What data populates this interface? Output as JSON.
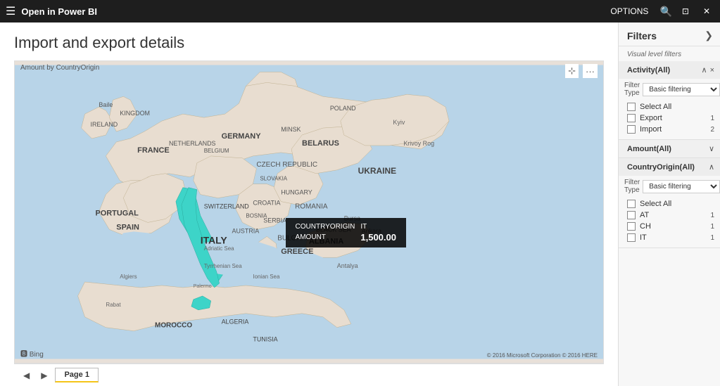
{
  "titlebar": {
    "title": "Open in Power BI",
    "options_label": "OPTIONS",
    "search_icon": "🔍",
    "window_controls": [
      "⊡",
      "×"
    ]
  },
  "page": {
    "title": "Import and export details",
    "nav": {
      "prev_arrow": "◀",
      "next_arrow": "▶",
      "page_label": "Page 1"
    }
  },
  "map": {
    "label": "Amount by CountryOrigin",
    "expand_icon": "⤢",
    "more_icon": "···",
    "bing_icon": "🅱",
    "bing_label": "Bing",
    "copyright": "© 2016 Microsoft Corporation  © 2016 HERE",
    "tooltip": {
      "country_origin_label": "COUNTRYORIGIN",
      "country_origin_value": "IT",
      "amount_label": "AMOUNT",
      "amount_value": "1,500.00"
    }
  },
  "filters": {
    "panel_title": "Filters",
    "expand_icon": "❯",
    "section_label": "Visual level filters",
    "groups": [
      {
        "name": "Activity(All)",
        "collapse_icon": "∧",
        "close_icon": "×",
        "filter_type_label": "Filter Type",
        "filter_type_value": "Basic filtering",
        "items": [
          {
            "label": "Select All",
            "count": "",
            "checked": false
          },
          {
            "label": "Export",
            "count": "1",
            "checked": false
          },
          {
            "label": "Import",
            "count": "2",
            "checked": false
          }
        ]
      },
      {
        "name": "Amount(All)",
        "collapsed": true,
        "collapse_icon": "∨"
      },
      {
        "name": "CountryOrigin(All)",
        "collapse_icon": "∧",
        "filter_type_label": "Filter Type",
        "filter_type_value": "Basic filtering",
        "items": [
          {
            "label": "Select All",
            "count": "",
            "checked": false
          },
          {
            "label": "AT",
            "count": "1",
            "checked": false
          },
          {
            "label": "CH",
            "count": "1",
            "checked": false
          },
          {
            "label": "IT",
            "count": "1",
            "checked": false
          }
        ]
      }
    ]
  }
}
